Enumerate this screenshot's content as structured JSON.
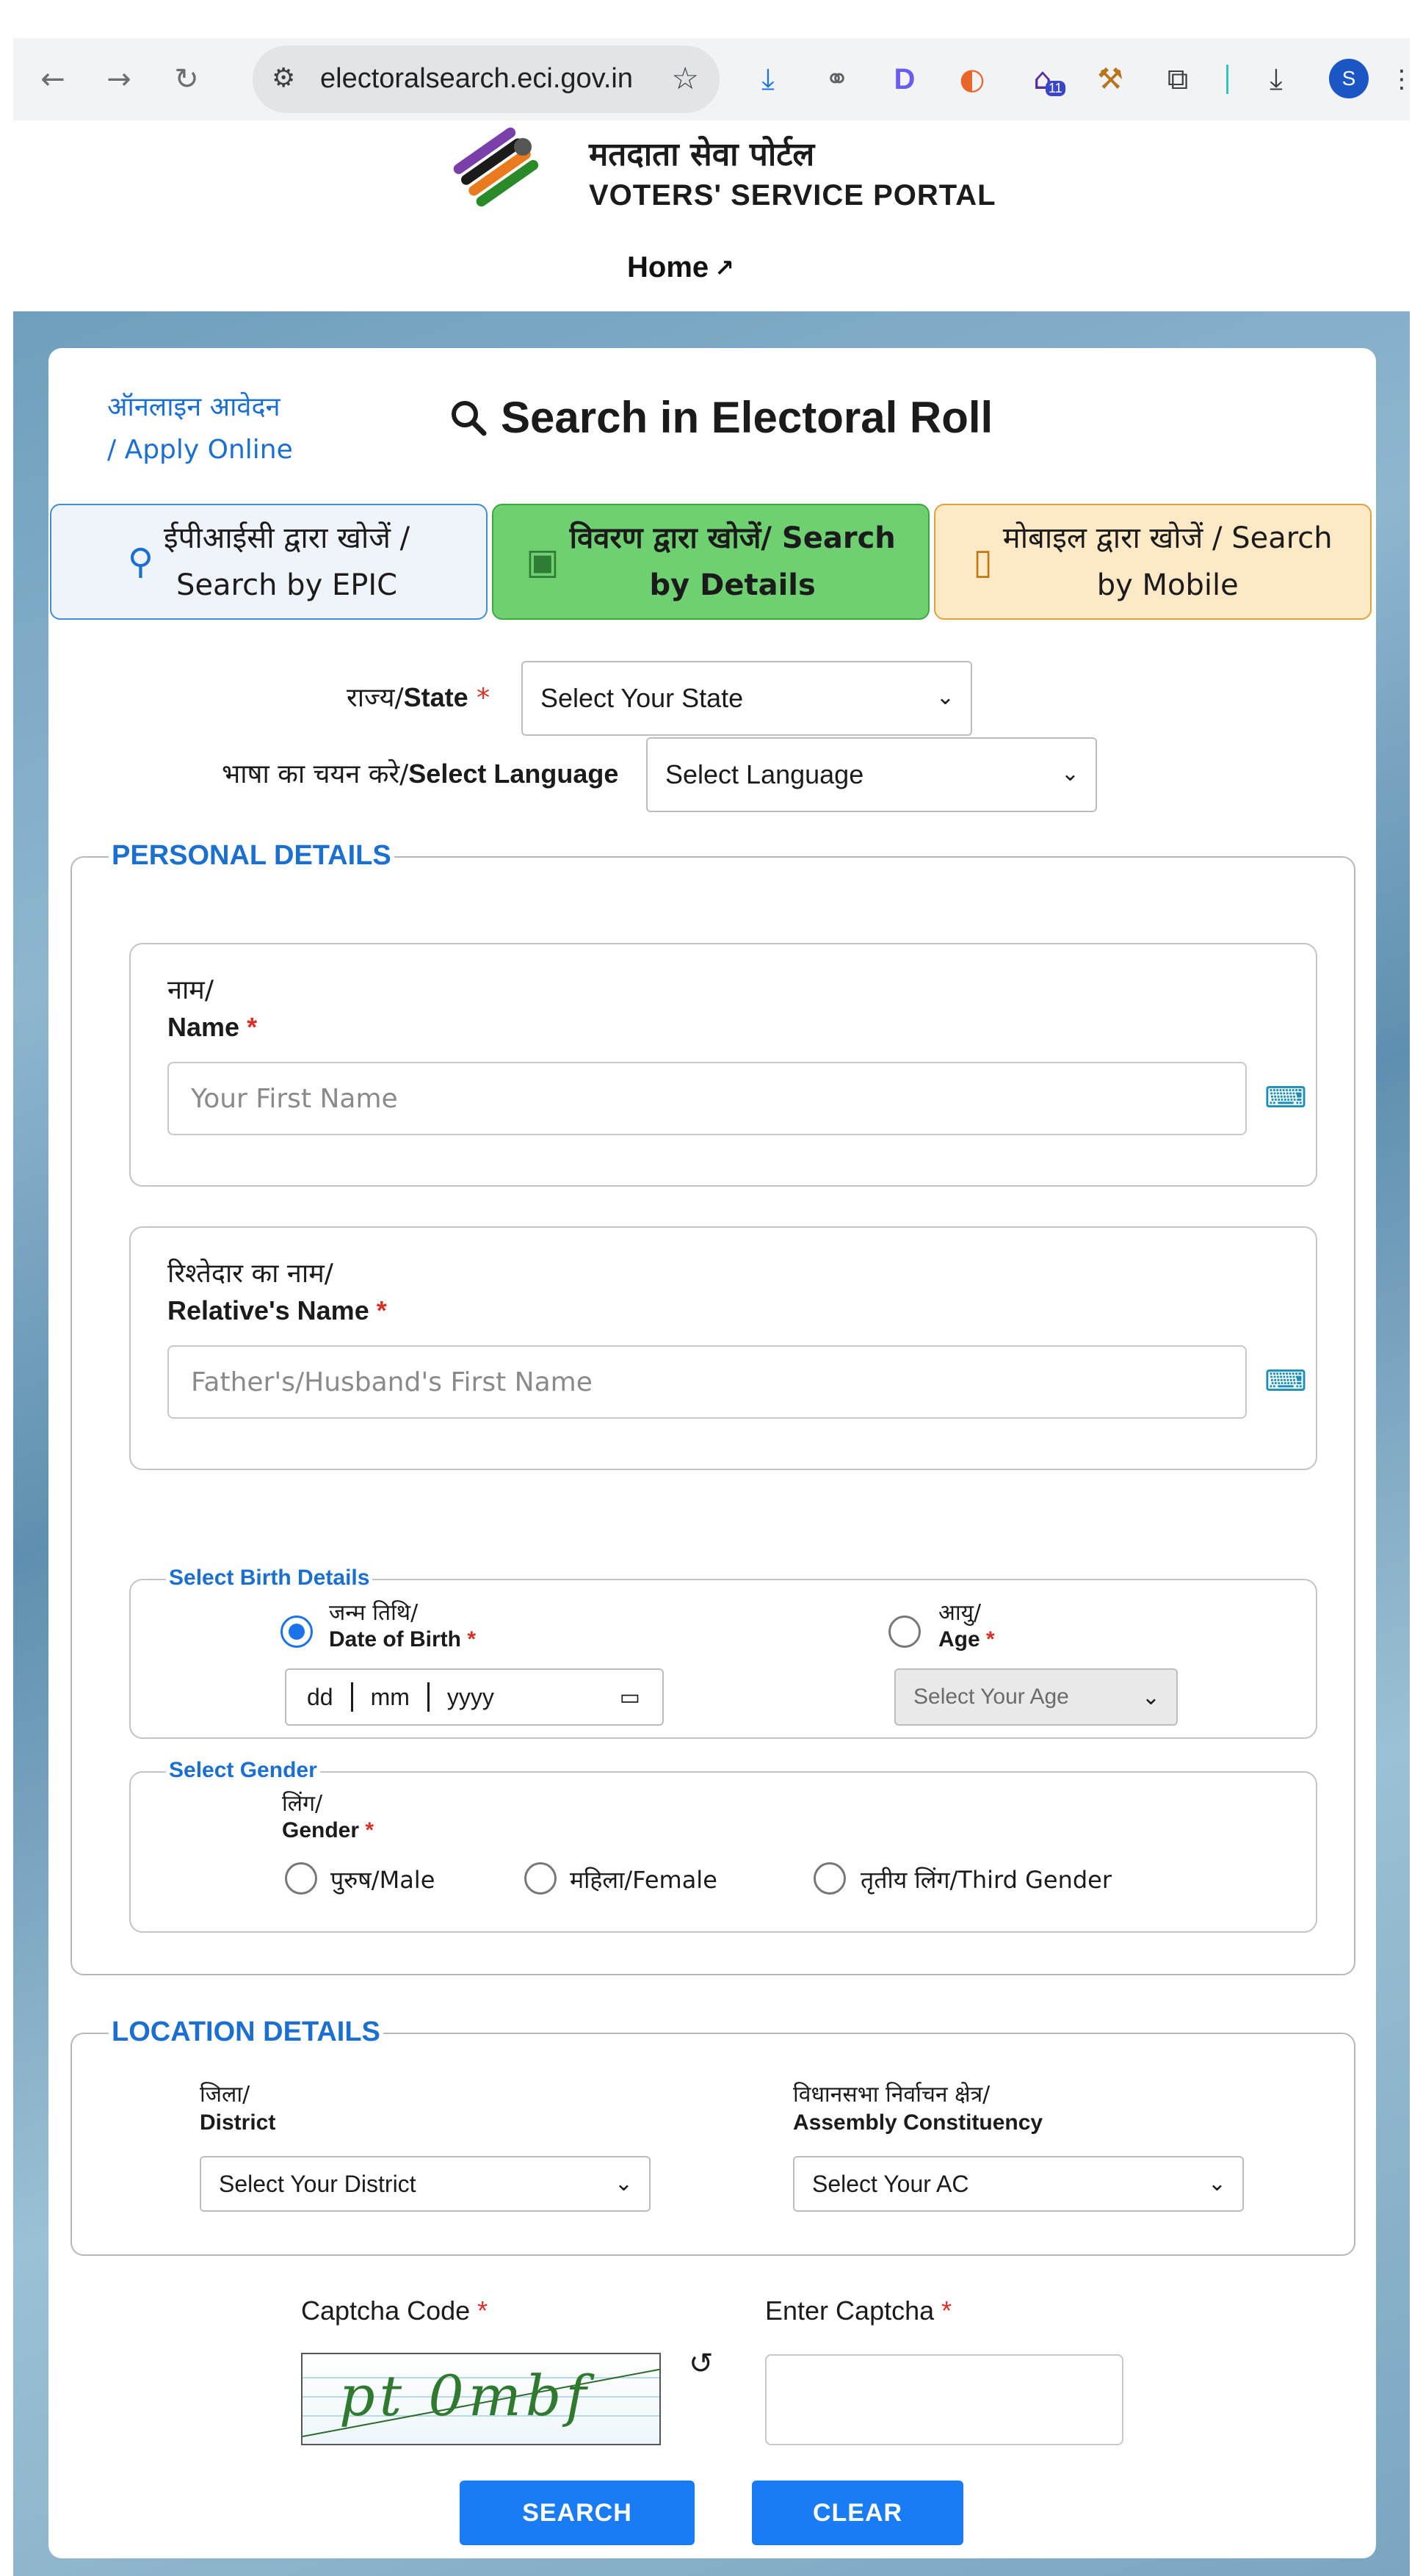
{
  "browser": {
    "url": "electoralsearch.eci.gov.in",
    "profile_initial": "S",
    "back_icon": "arrow-left-icon",
    "forward_icon": "arrow-right-icon",
    "reload_icon": "reload-icon",
    "extension_badge": "11"
  },
  "header": {
    "brand_hindi": "मतदाता सेवा पोर्टल",
    "brand_english": "VOTERS' SERVICE PORTAL",
    "home_link": "Home"
  },
  "card": {
    "apply_line1": "ऑनलाइन आवेदन",
    "apply_line2": "/ Apply Online",
    "title": "Search in Electoral Roll"
  },
  "tabs": [
    {
      "line1": "ईपीआईसी द्वारा खोजें /",
      "line2": "Search by EPIC"
    },
    {
      "line1": "विवरण द्वारा खोजें/ Search",
      "line2": "by Details"
    },
    {
      "line1": "मोबाइल द्वारा खोजें / Search",
      "line2": "by Mobile"
    }
  ],
  "state": {
    "label_hi": "राज्य/",
    "label_en": "State",
    "required": "*",
    "selected": "Select Your State"
  },
  "language": {
    "label_hi": "भाषा का चयन करे/",
    "label_en": "Select Language",
    "selected": "Select Language"
  },
  "personal": {
    "legend": "PERSONAL DETAILS",
    "name_label_hi": "नाम/",
    "name_label_en": "Name",
    "name_placeholder": "Your First Name",
    "relative_label_hi": "रिश्तेदार का नाम/",
    "relative_label_en": "Relative's Name",
    "relative_placeholder": "Father's/Husband's First Name",
    "required": "*"
  },
  "birth": {
    "legend": "Select Birth Details",
    "dob_label_hi": "जन्म तिथि/",
    "dob_label_en": "Date of Birth",
    "dob_selected": true,
    "age_label_hi": "आयु/",
    "age_label_en": "Age",
    "date_dd": "dd",
    "date_mm": "mm",
    "date_yyyy": "yyyy",
    "age_selected": "Select Your Age",
    "required": "*"
  },
  "gender": {
    "legend": "Select Gender",
    "label_hi": "लिंग/",
    "label_en": "Gender",
    "required": "*",
    "options": [
      "पुरुष/Male",
      "महिला/Female",
      "तृतीय लिंग/Third Gender"
    ]
  },
  "location": {
    "legend": "LOCATION DETAILS",
    "district_hi": "जिला/",
    "district_en": "District",
    "district_selected": "Select Your District",
    "ac_hi": "विधानसभा निर्वाचन क्षेत्र/",
    "ac_en": "Assembly Constituency",
    "ac_selected": "Select Your AC"
  },
  "captcha": {
    "code_label": "Captcha Code",
    "enter_label": "Enter Captcha",
    "required": "*",
    "image_text": "pt 0mbf"
  },
  "buttons": {
    "search": "SEARCH",
    "clear": "CLEAR"
  },
  "colors": {
    "accent": "#1a7cf5",
    "legend_blue": "#1a6fd1",
    "tab_green": "#6fd072",
    "tab_orange": "#fde9c6",
    "tab_blue": "#eef4f9"
  }
}
